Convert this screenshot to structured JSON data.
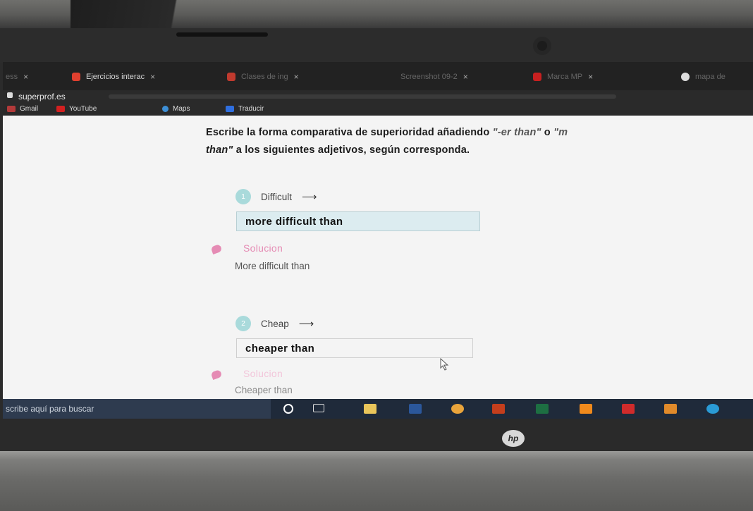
{
  "browser": {
    "tabs": [
      {
        "label": "ess",
        "icon": "page-icon",
        "dim": true
      },
      {
        "label": "Ejercicios interac",
        "icon": "superprof-icon",
        "active": true
      },
      {
        "label": "Clases de ing",
        "icon": "superprof-icon",
        "dim": true
      },
      {
        "label": "Screenshot 09-2",
        "icon": "image-icon",
        "dim": true
      },
      {
        "label": "Marca MP",
        "icon": "youtube-icon",
        "dim": true
      },
      {
        "label": "mapa de",
        "icon": "google-icon",
        "dim": true
      }
    ],
    "url": "superprof.es",
    "bookmarks": [
      {
        "label": "Gmail",
        "icon": "gmail-icon",
        "color": "#b33a3a"
      },
      {
        "label": "YouTube",
        "icon": "youtube-icon",
        "color": "#d32020"
      },
      {
        "label": "Maps",
        "icon": "maps-icon",
        "color": "#3d8fd6"
      },
      {
        "label": "Traducir",
        "icon": "translate-icon",
        "color": "#2f6fe0"
      }
    ]
  },
  "exercise": {
    "instruction_part1": "Escribe la forma comparativa de superioridad añadiendo ",
    "instruction_er": "\"-er than\"",
    "instruction_part2": " o ",
    "instruction_more": "\"m",
    "instruction_line2_italic": "than\"",
    "instruction_line2_rest": " a los siguientes adjetivos, según corresponda.",
    "questions": [
      {
        "number": "1",
        "word": "Difficult",
        "arrow": "⟶",
        "answer": "more difficult than",
        "solution_label": "Solucion",
        "solution": "More difficult than"
      },
      {
        "number": "2",
        "word": "Cheap",
        "arrow": "⟶",
        "answer": "cheaper than",
        "solution_label": "Solucion",
        "solution": "Cheaper than"
      }
    ]
  },
  "taskbar": {
    "search_placeholder": "scribe aquí para buscar",
    "items": [
      {
        "icon": "cortana-icon",
        "color": "#ffffff"
      },
      {
        "icon": "task-view-icon",
        "color": "#ffffff"
      },
      {
        "icon": "file-explorer-icon",
        "color": "#e9c55a"
      },
      {
        "icon": "word-icon",
        "color": "#2b579a"
      },
      {
        "icon": "chrome-icon",
        "color": "#e9a43b"
      },
      {
        "icon": "powerpoint-icon",
        "color": "#c43e1c"
      },
      {
        "icon": "excel-icon",
        "color": "#1d6f42"
      },
      {
        "icon": "vlc-icon",
        "color": "#f08a1c"
      },
      {
        "icon": "acrobat-icon",
        "color": "#d02b2b"
      },
      {
        "icon": "app-icon",
        "color": "#e08a2a"
      },
      {
        "icon": "edge-icon",
        "color": "#2a9bd6"
      }
    ]
  },
  "device": {
    "logo": "hp"
  }
}
